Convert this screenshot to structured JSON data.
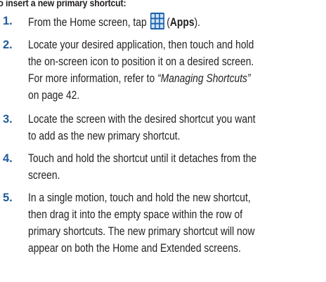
{
  "heading": "To insert a new primary shortcut:",
  "steps": [
    {
      "number": "1.",
      "before": "From the Home screen, tap",
      "icon": "apps-grid-icon",
      "open_paren": "(",
      "bold": "Apps",
      "close": ")."
    },
    {
      "number": "2.",
      "line1": "Locate your desired application, then touch and hold",
      "line2": "the on-screen icon to position it on a desired screen.",
      "line3_prefix": "For more information, refer to ",
      "line3_ref": "“Managing Shortcuts”",
      "line4": "on page 42."
    },
    {
      "number": "3.",
      "line1": "Locate the screen with the desired shortcut you want",
      "line2": "to add as the new primary shortcut."
    },
    {
      "number": "4.",
      "line1": "Touch and hold the shortcut until it detaches from the",
      "line2": "screen."
    },
    {
      "number": "5.",
      "line1": "In a single motion, touch and hold the new shortcut,",
      "line2": "then drag it into the empty space within the row of",
      "line3": "primary shortcuts. The new primary shortcut will now",
      "line4": "appear on both the Home and Extended screens."
    }
  ],
  "colors": {
    "step_number": "#1f5c99",
    "body_text": "#231f20",
    "icon_bg": "#1a5fa8",
    "icon_cell": "#cfe3f7"
  }
}
